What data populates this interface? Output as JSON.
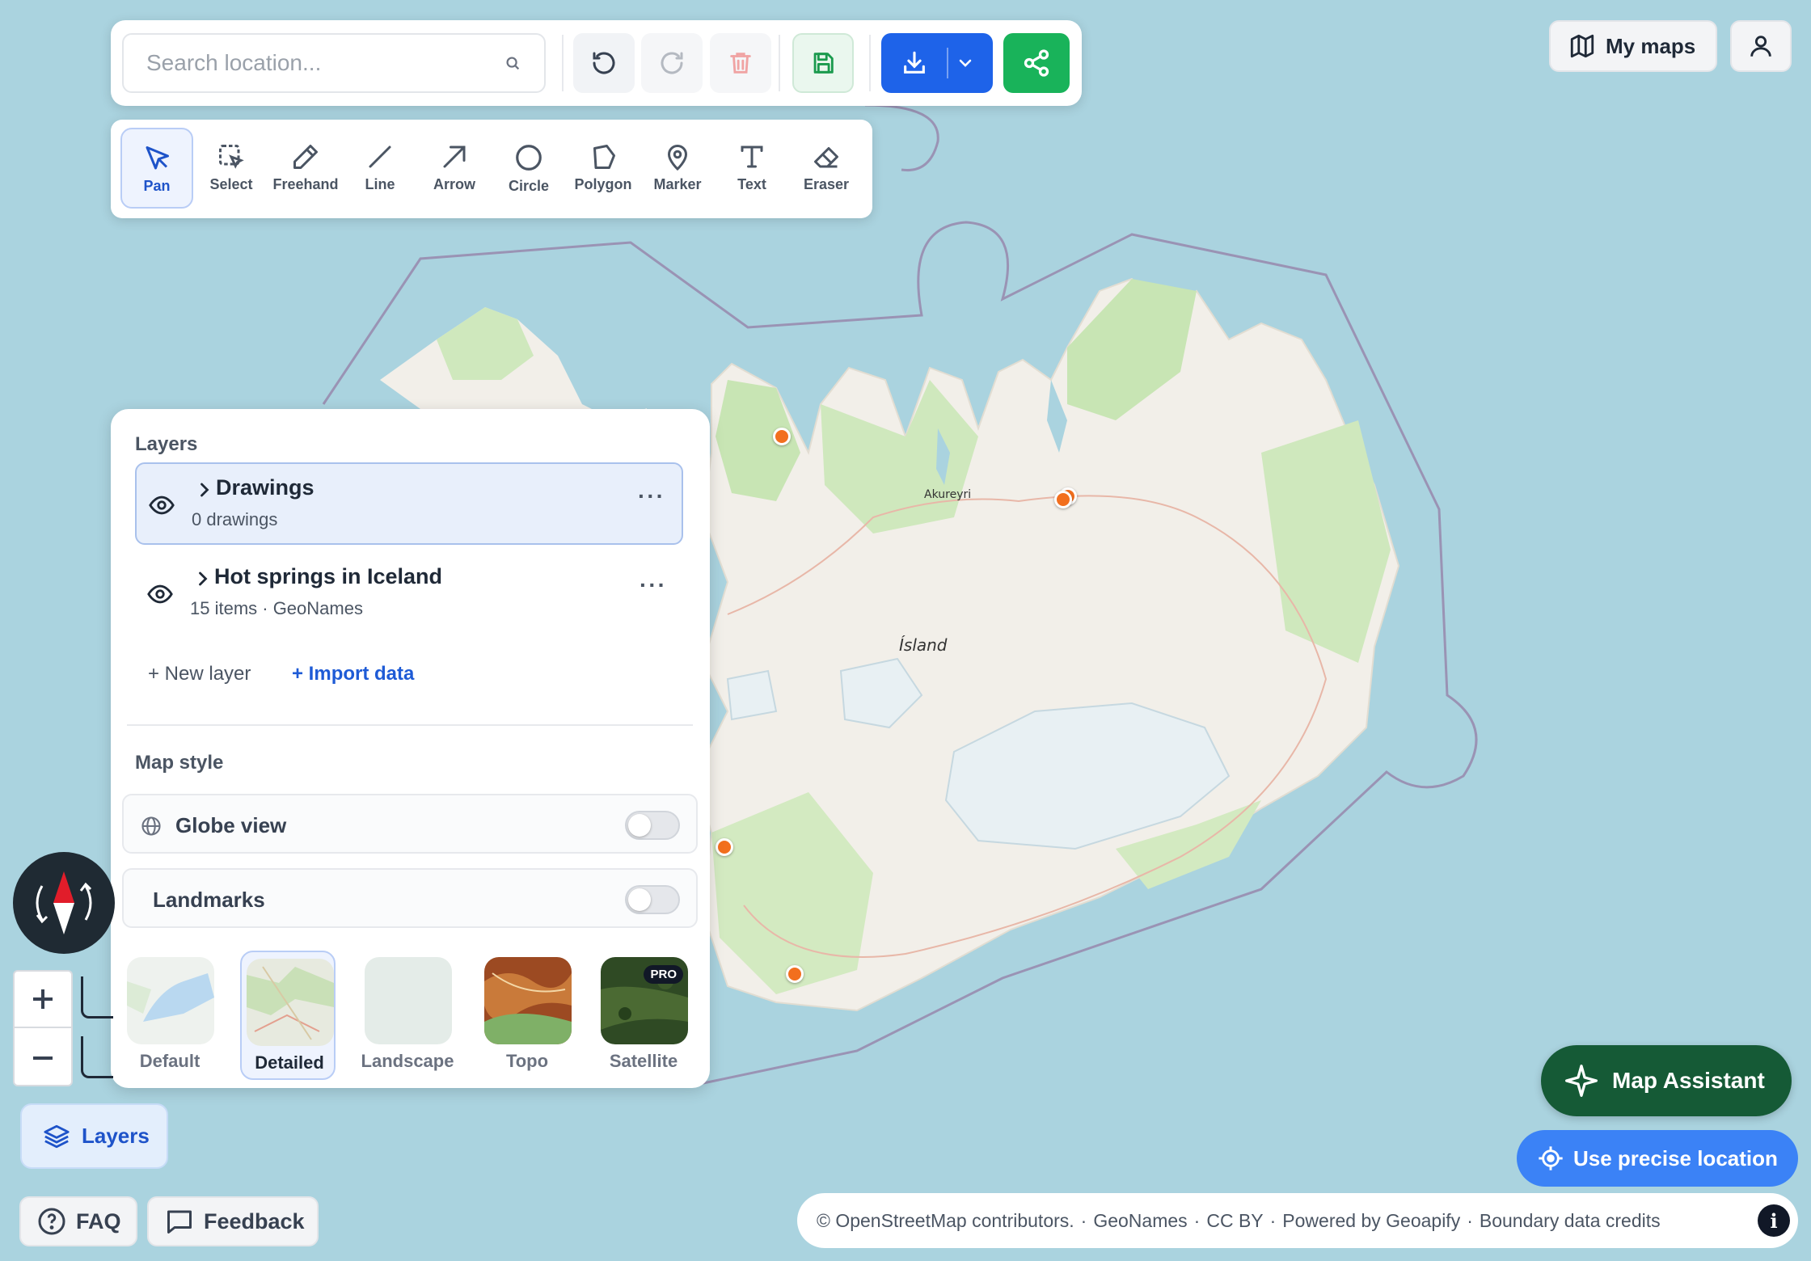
{
  "search": {
    "placeholder": "Search location..."
  },
  "draw_tools": [
    {
      "label": "Pan",
      "active": true
    },
    {
      "label": "Select"
    },
    {
      "label": "Freehand"
    },
    {
      "label": "Line"
    },
    {
      "label": "Arrow"
    },
    {
      "label": "Circle"
    },
    {
      "label": "Polygon"
    },
    {
      "label": "Marker"
    },
    {
      "label": "Text"
    },
    {
      "label": "Eraser"
    }
  ],
  "top_right": {
    "my_maps_label": "My maps"
  },
  "map": {
    "labels": {
      "city": "Akureyri",
      "country": "Ísland"
    },
    "marker_color": "#f26f1e"
  },
  "layers_panel": {
    "title": "Layers",
    "layers": [
      {
        "name": "Drawings",
        "subtitle": "0 drawings",
        "selected": true,
        "visible": true
      },
      {
        "name": "Hot springs in Iceland",
        "subtitle": "15 items · GeoNames",
        "visible": true
      }
    ],
    "new_layer_label": "+ New layer",
    "import_label": "+ Import data",
    "map_style_title": "Map style",
    "toggles": [
      {
        "label": "Globe view",
        "on": false
      },
      {
        "label": "Landmarks",
        "on": false
      }
    ],
    "styles": [
      {
        "label": "Default"
      },
      {
        "label": "Detailed",
        "active": true
      },
      {
        "label": "Landscape"
      },
      {
        "label": "Topo"
      },
      {
        "label": "Satellite",
        "badge": "PRO"
      }
    ]
  },
  "bottom_left": {
    "layers_button_label": "Layers",
    "faq_label": "FAQ",
    "feedback_label": "Feedback"
  },
  "bottom_right": {
    "assistant_label": "Map Assistant",
    "precise_location_label": "Use precise location",
    "attribution": {
      "osm": "© OpenStreetMap contributors.",
      "geonames": "GeoNames",
      "license": "CC BY",
      "powered": "Powered by Geoapify",
      "boundary": "Boundary data credits"
    },
    "info_label": "i"
  },
  "colors": {
    "water": "#aad3df",
    "primary_blue": "#1e63e9",
    "share_green": "#19b35a",
    "assistant_green": "#155a36",
    "location_blue": "#3b82f6"
  }
}
